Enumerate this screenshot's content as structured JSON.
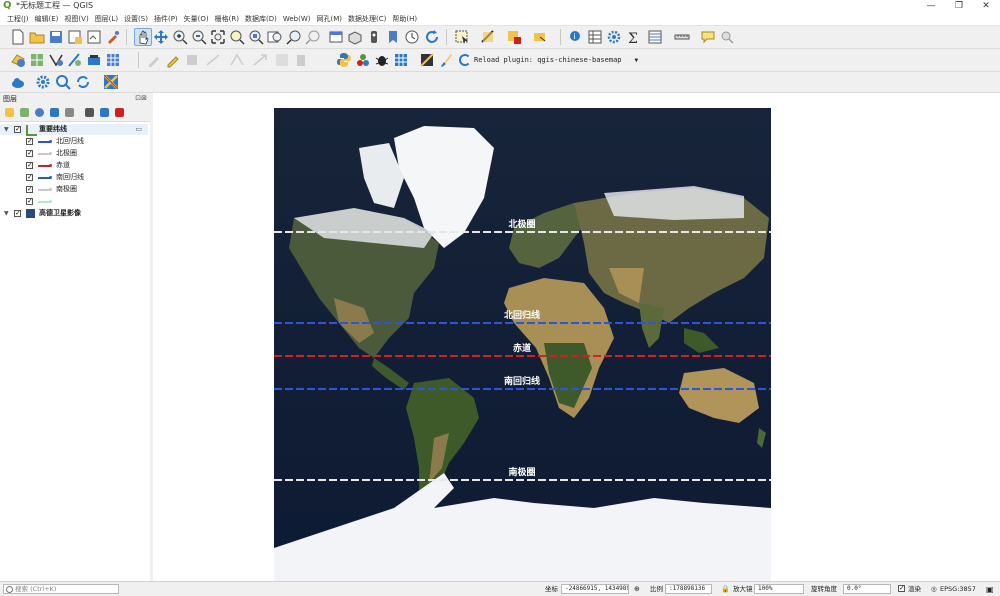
{
  "window": {
    "title": "*无标题工程 — QGIS",
    "app_icon": "qgis-logo-icon"
  },
  "menu": [
    "工程(J)",
    "编辑(E)",
    "视图(V)",
    "图层(L)",
    "设置(S)",
    "插件(P)",
    "矢量(O)",
    "栅格(R)",
    "数据库(D)",
    "Web(W)",
    "网孔(M)",
    "数据处理(C)",
    "帮助(H)"
  ],
  "plugin_toolbar": {
    "reload_label": "Reload plugin: qgis-chinese-basemap"
  },
  "layers_panel": {
    "title": "图层",
    "groups": [
      {
        "name": "重要纬线",
        "checked": true,
        "items": [
          {
            "name": "北回归线",
            "color": "#2d55d8",
            "checked": true
          },
          {
            "name": "北极圈",
            "color": "#c8c8c8",
            "checked": true
          },
          {
            "name": "赤道",
            "color": "#d02020",
            "checked": true
          },
          {
            "name": "南回归线",
            "color": "#2d55d8",
            "checked": true
          },
          {
            "name": "南极圈",
            "color": "#c8c8c8",
            "checked": true
          },
          {
            "name": "",
            "color": "#b8e6c8",
            "checked": true
          }
        ]
      },
      {
        "name": "高德卫星影像",
        "checked": true,
        "items": []
      }
    ]
  },
  "map": {
    "lines": [
      {
        "label": "北极圈",
        "color": "#e6e6e6"
      },
      {
        "label": "北回归线",
        "color": "#2d55d8"
      },
      {
        "label": "赤道",
        "color": "#d02020"
      },
      {
        "label": "南回归线",
        "color": "#2d55d8"
      },
      {
        "label": "南极圈",
        "color": "#e6e6e6"
      }
    ]
  },
  "statusbar": {
    "search_placeholder": "搜索 (Ctrl+K)",
    "coordinate_label": "坐标",
    "coordinate_value": "-24866915, 14349893",
    "scale_label": "比例",
    "scale_value": ":178898136",
    "magnifier_label": "放大镜",
    "magnifier_value": "100%",
    "rotation_label": "旋转角度",
    "rotation_value": "0.0°",
    "render_label": "渲染",
    "render_checked": true,
    "crs_value": "EPSG:3857"
  }
}
